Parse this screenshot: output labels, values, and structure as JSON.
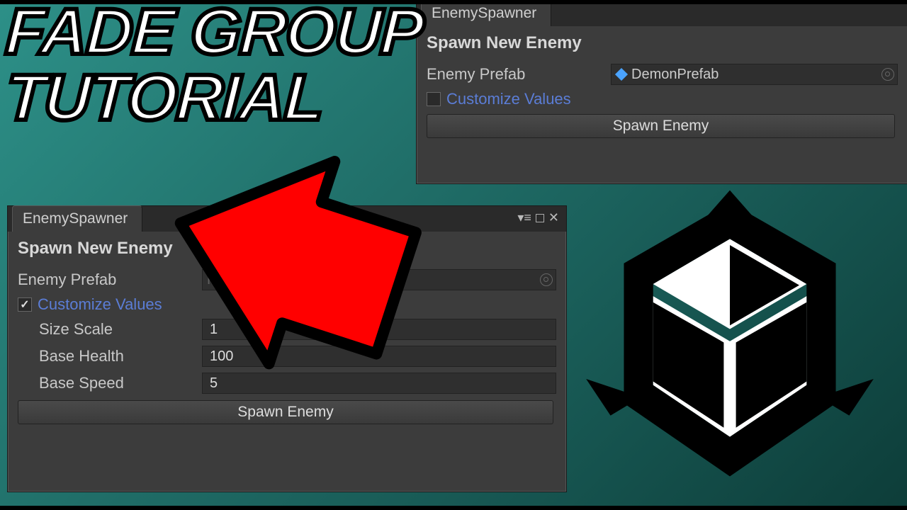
{
  "title": {
    "line1": "FADE GROUP",
    "line2": "TUTORIAL"
  },
  "window_top": {
    "tab": "EnemySpawner",
    "section": "Spawn New Enemy",
    "prefab_label": "Enemy Prefab",
    "prefab_value": "DemonPrefab",
    "customize_label": "Customize Values",
    "spawn_button": "Spawn Enemy"
  },
  "window_bottom": {
    "tab": "EnemySpawner",
    "section": "Spawn New Enemy",
    "prefab_label": "Enemy Prefab",
    "prefab_value": "Prefab",
    "customize_label": "Customize Values",
    "fields": {
      "size": {
        "label": "Size Scale",
        "value": "1"
      },
      "health": {
        "label": "Base Health",
        "value": "100"
      },
      "speed": {
        "label": "Base Speed",
        "value": "5"
      }
    },
    "spawn_button": "Spawn Enemy"
  }
}
